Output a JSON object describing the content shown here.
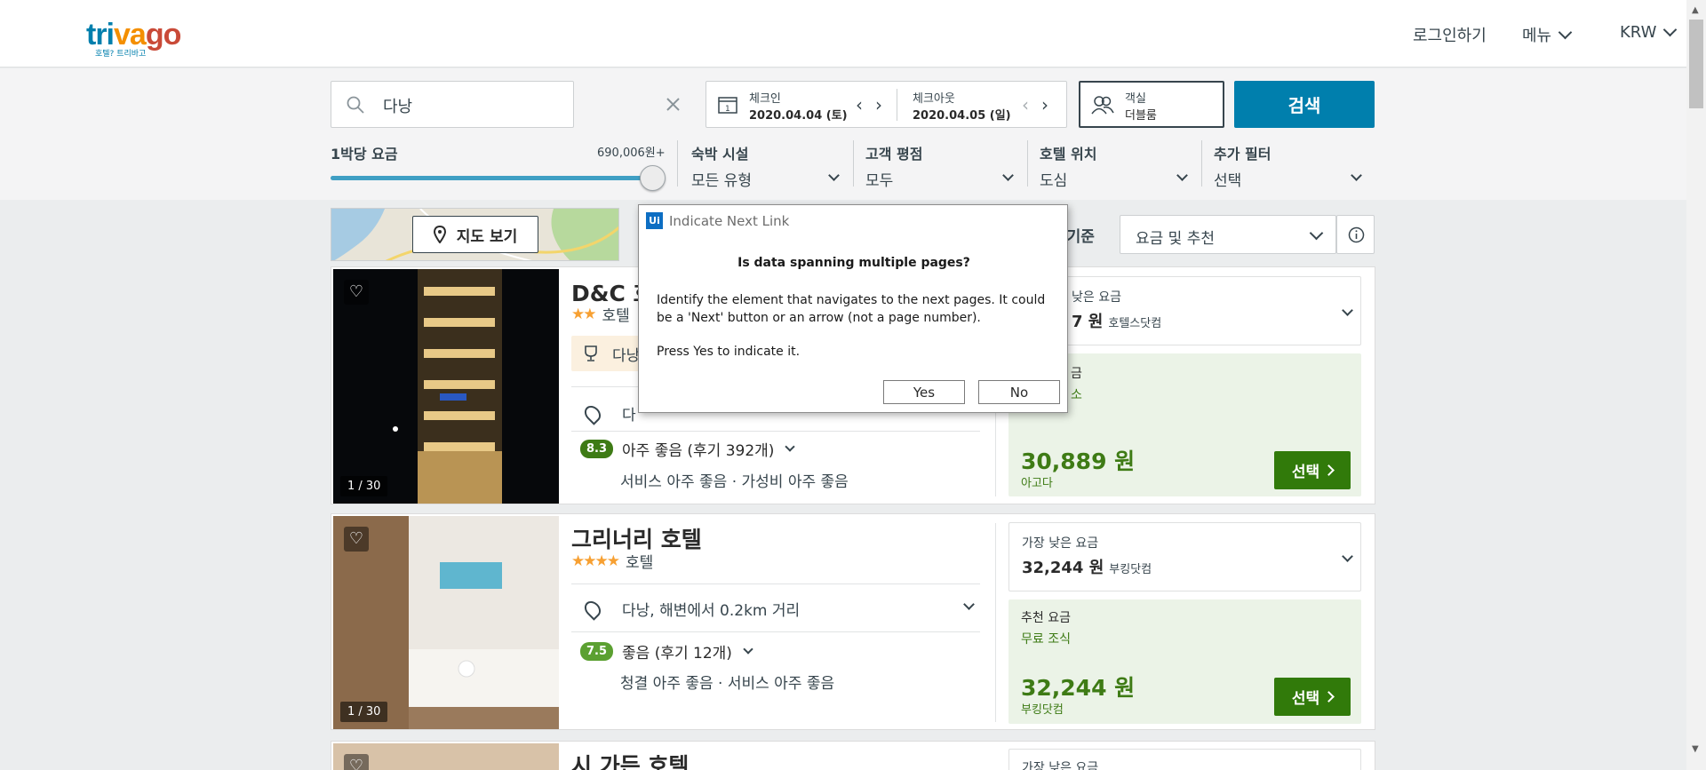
{
  "header": {
    "logo_text": "trivago",
    "logo_sub": "호텔? 트리바고",
    "login": "로그인하기",
    "menu": "메뉴",
    "currency": "KRW"
  },
  "search": {
    "destination": "다낭",
    "checkin_label": "체크인",
    "checkin_date": "2020.04.04 (토)",
    "checkout_label": "체크아웃",
    "checkout_date": "2020.04.05 (일)",
    "calendar_day": "1",
    "guests_label": "객실",
    "guests_value": "더블룸",
    "search_button": "검색"
  },
  "filters": {
    "price_label": "1박당 요금",
    "price_value": "690,006원+",
    "price_fill": 1.0,
    "lodging_label": "숙박 시설",
    "lodging_value": "모든 유형",
    "rating_label": "고객 평점",
    "rating_value": "모두",
    "location_label": "호텔 위치",
    "location_value": "도심",
    "more_label": "추가 필터",
    "more_value": "선택"
  },
  "toolbar": {
    "map_button": "지도 보기",
    "sort_label_partial": "렬기준",
    "sort_value": "요금 및 추천"
  },
  "results": [
    {
      "name": "D&C 호",
      "stars": "★★",
      "type": "호텔",
      "award": "다낭",
      "location": "다",
      "rating_score": "8.3",
      "rating_text": "아주 좋음 (후기 392개)",
      "rating_color": "#3e7b15",
      "highlights": "서비스 아주 좋음 · 가성비 아주 좋음",
      "photo_counter": "1 / 30",
      "lowest_label": "낮은 요금",
      "lowest_price": "7 원",
      "lowest_site": "호텔스닷컴",
      "rec_label": "금",
      "rec_note": "소",
      "rec_price": "30,889 원",
      "rec_site": "아고다",
      "select": "선택"
    },
    {
      "name": "그리너리 호텔",
      "stars": "★★★★",
      "type": "호텔",
      "location": "다낭, 해변에서 0.2km 거리",
      "rating_score": "7.5",
      "rating_text": "좋음 (후기 12개)",
      "rating_color": "#5ba031",
      "highlights": "청결 아주 좋음 · 서비스 아주 좋음",
      "photo_counter": "1 / 30",
      "lowest_label": "가장 낮은 요금",
      "lowest_price": "32,244 원",
      "lowest_site": "부킹닷컴",
      "rec_label": "추천 요금",
      "rec_note": "무료 조식",
      "rec_price": "32,244 원",
      "rec_site": "부킹닷컴",
      "select": "선택"
    },
    {
      "name": "시 가든 호텔",
      "lowest_label": "가장 낮은 요금"
    }
  ],
  "dialog": {
    "title": "Indicate Next Link",
    "logo": "Ui",
    "question": "Is data spanning multiple pages?",
    "body": "Identify the element that navigates to the next pages. It could be a 'Next' button or an arrow (not a page number).",
    "instruction": "Press Yes to indicate it.",
    "yes": "Yes",
    "no": "No"
  }
}
